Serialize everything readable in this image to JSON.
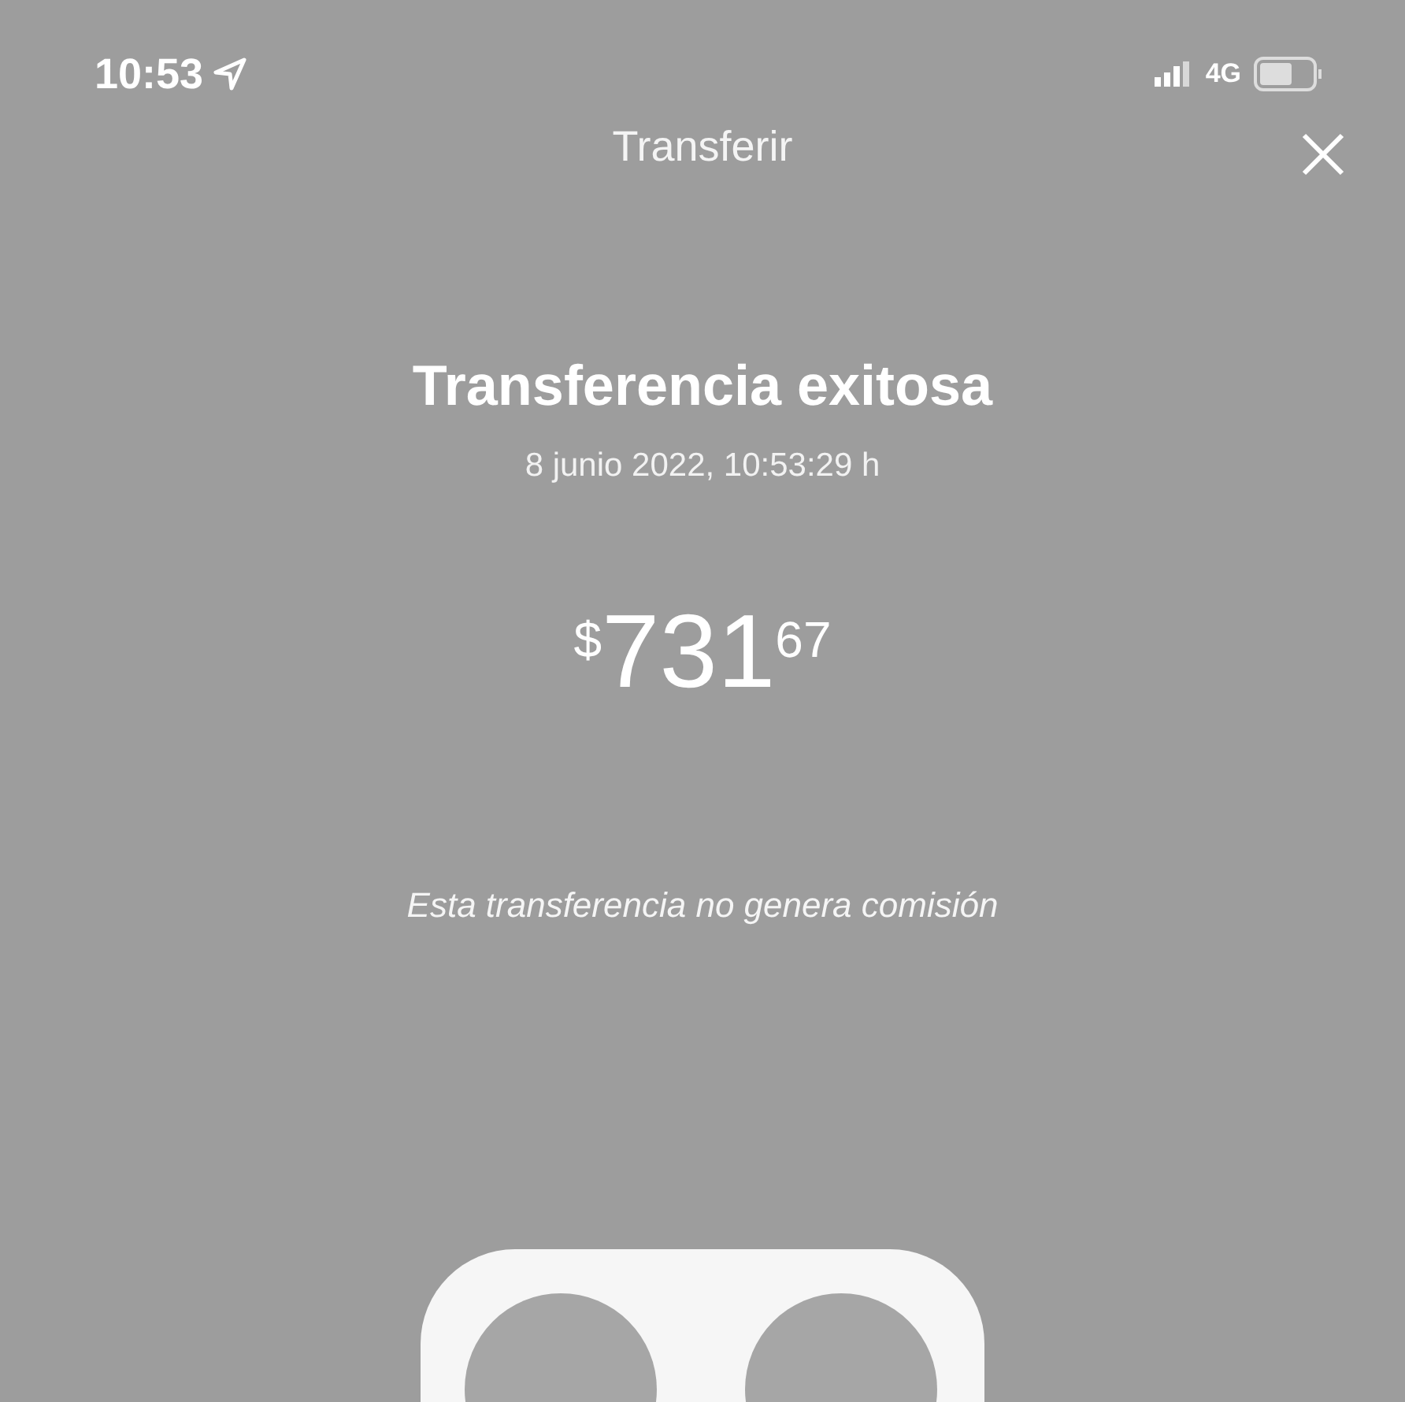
{
  "status_bar": {
    "time": "10:53",
    "network": "4G"
  },
  "header": {
    "title": "Transferir"
  },
  "receipt": {
    "heading": "Transferencia exitosa",
    "date": "8 junio 2022, 10:53:29 h",
    "amount": {
      "currency": "$",
      "whole": "731",
      "cents": "67"
    },
    "note": "Esta transferencia no genera comisión"
  },
  "participants": [
    {
      "kind": "avatar"
    },
    {
      "kind": "avatar"
    }
  ]
}
